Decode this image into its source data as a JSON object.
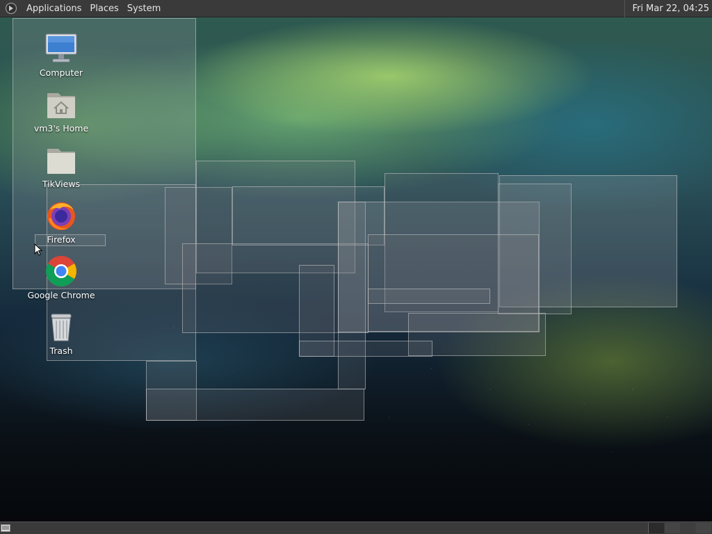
{
  "top_panel": {
    "menus": [
      "Applications",
      "Places",
      "System"
    ],
    "clock": "Fri Mar 22, 04:25"
  },
  "desktop_icons": [
    {
      "label": "Computer",
      "icon": "computer-icon"
    },
    {
      "label": "vm3's Home",
      "icon": "home-folder-icon"
    },
    {
      "label": "TikViews",
      "icon": "folder-icon"
    },
    {
      "label": "Firefox",
      "icon": "firefox-icon"
    },
    {
      "label": "Google Chrome",
      "icon": "chrome-icon"
    },
    {
      "label": "Trash",
      "icon": "trash-icon"
    }
  ],
  "bottom_panel": {
    "show_desktop_icon": "show-desktop-icon"
  }
}
